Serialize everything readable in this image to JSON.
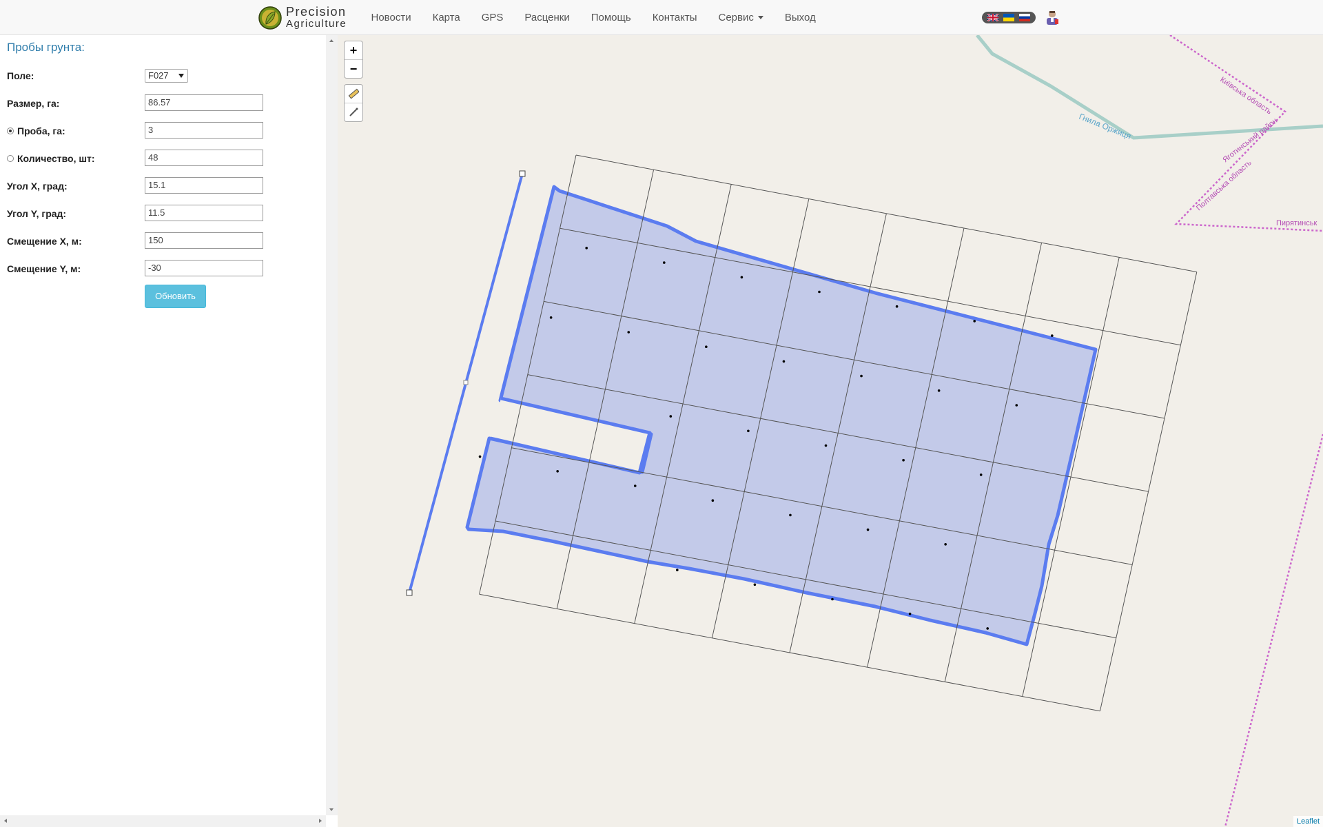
{
  "brand": {
    "line1": "Precision",
    "line2": "Agriculture"
  },
  "nav": {
    "items": [
      "Новости",
      "Карта",
      "GPS",
      "Расценки",
      "Помощь",
      "Контакты",
      "Сервис",
      "Выход"
    ]
  },
  "languages": [
    "EN",
    "UA",
    "RU"
  ],
  "panel": {
    "title": "Пробы грунта:",
    "field_label": "Поле:",
    "field_value": "F027",
    "size_label": "Размер, га:",
    "size_value": "86.57",
    "sample_label": "Проба, га:",
    "sample_value": "3",
    "count_label": "Количество, шт:",
    "count_value": "48",
    "angle_x_label": "Угол X, град:",
    "angle_x_value": "15.1",
    "angle_y_label": "Угол Y, град:",
    "angle_y_value": "11.5",
    "offset_x_label": "Смещение X, м:",
    "offset_x_value": "150",
    "offset_y_label": "Смещение Y, м:",
    "offset_y_value": "-30",
    "update_button": "Обновить",
    "selected_mode": "sample"
  },
  "map": {
    "zoom_in": "+",
    "zoom_out": "−",
    "labels": {
      "river": "Гнила Оржиця",
      "kyiv_region": "Київська область",
      "yagotyn_district": "Яготинський район",
      "poltava_region": "Полтавська область",
      "pyriatyn": "Пирятинськ"
    },
    "attribution": "Leaflet"
  },
  "colors": {
    "field_fill": "#a9b5ea",
    "field_stroke": "#5b7cf0",
    "grid": "#555555",
    "boundary": "#cc66cc",
    "river": "#a8cfc8",
    "button": "#5bc0de",
    "link": "#317eac"
  }
}
